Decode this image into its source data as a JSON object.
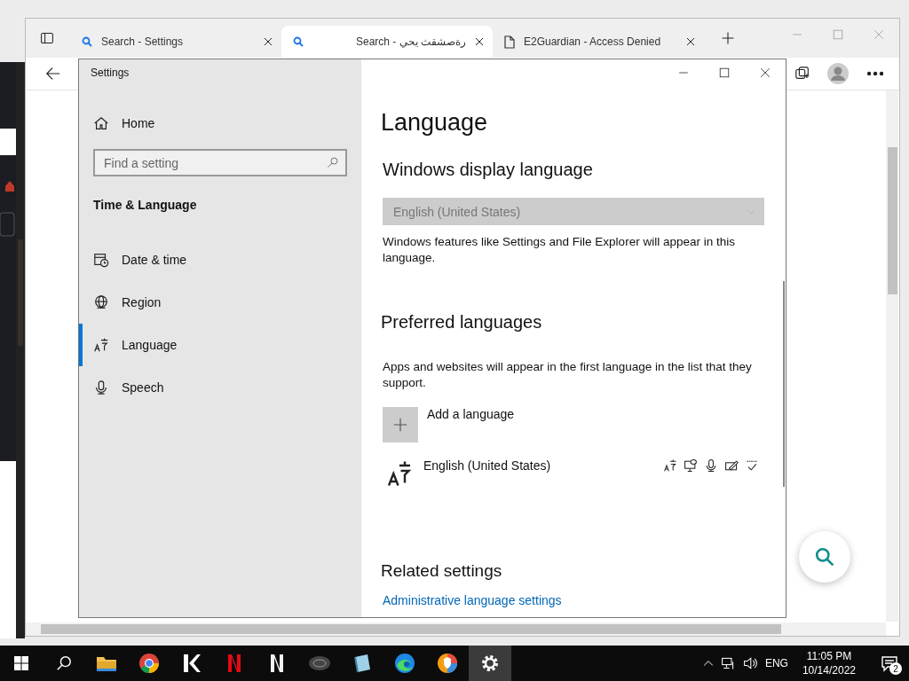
{
  "browser": {
    "tabs": [
      {
        "kind": "search",
        "title": "Search - Settings",
        "selected": false
      },
      {
        "kind": "search",
        "title": "Search - رةصشقث يحي",
        "selected": true
      },
      {
        "kind": "document",
        "title": "E2Guardian - Access Denied",
        "selected": false
      }
    ]
  },
  "settings": {
    "title": "Settings",
    "sidebar": {
      "home": "Home",
      "search": {
        "placeholder": "Find a setting"
      },
      "section": "Time & Language",
      "items": [
        {
          "kind": "calendar",
          "label": "Date & time",
          "selected": false
        },
        {
          "kind": "globe",
          "label": "Region",
          "selected": false
        },
        {
          "kind": "language",
          "label": "Language",
          "selected": true
        },
        {
          "kind": "microphone",
          "label": "Speech",
          "selected": false
        }
      ]
    },
    "content": {
      "heading": "Language",
      "display": {
        "heading": "Windows display language",
        "dropdown": {
          "value": "English (United States)",
          "disabled": true
        },
        "description": "Windows features like Settings and File Explorer will appear in this language."
      },
      "preferred": {
        "heading": "Preferred languages",
        "description": "Apps and websites will appear in the first language in the list that they support.",
        "add_label": "Add a language",
        "languages": [
          {
            "name": "English (United States)",
            "features": [
              {
                "kind": "language-pack"
              },
              {
                "kind": "text-to-speech"
              },
              {
                "kind": "speech"
              },
              {
                "kind": "handwriting"
              },
              {
                "kind": "spell-check"
              }
            ]
          }
        ]
      },
      "related": {
        "heading": "Related settings",
        "links": [
          "Administrative language settings"
        ]
      }
    }
  },
  "taskbar": {
    "apps": [
      {
        "kind": "folder",
        "selected": false
      },
      {
        "kind": "chrome",
        "selected": false
      },
      {
        "kind": "k",
        "selected": false
      },
      {
        "kind": "netflix",
        "selected": false
      },
      {
        "kind": "n",
        "selected": false
      },
      {
        "kind": "disc",
        "selected": false
      },
      {
        "kind": "notebook",
        "selected": false
      },
      {
        "kind": "edge",
        "selected": false
      },
      {
        "kind": "shield",
        "selected": false
      },
      {
        "kind": "gear",
        "selected": true
      }
    ],
    "tray": {
      "language": "ENG",
      "time": "11:05 PM",
      "date": "10/14/2022",
      "notifications": "2"
    }
  }
}
